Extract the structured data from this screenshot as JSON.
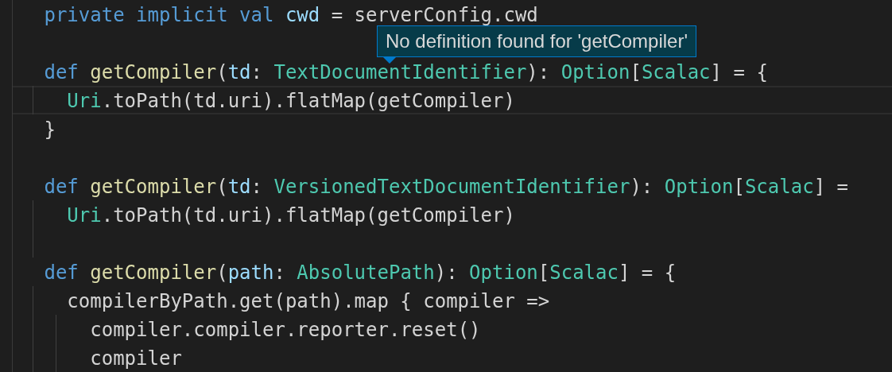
{
  "editor": {
    "lines": [
      {
        "highlighted": false,
        "tokens": [
          {
            "kind": "keyword",
            "text": "private implicit val "
          },
          {
            "kind": "parameter",
            "text": "cwd"
          },
          {
            "kind": "plain",
            "text": " = serverConfig.cwd"
          }
        ]
      },
      {
        "highlighted": false
      },
      {
        "highlighted": false,
        "tokens": [
          {
            "kind": "keyword",
            "text": "def "
          },
          {
            "kind": "function",
            "text": "getCompiler"
          },
          {
            "kind": "plain",
            "text": "("
          },
          {
            "kind": "parameter",
            "text": "td"
          },
          {
            "kind": "plain",
            "text": ": "
          },
          {
            "kind": "type",
            "text": "TextDocumentIdentifier"
          },
          {
            "kind": "plain",
            "text": "): "
          },
          {
            "kind": "type",
            "text": "Option"
          },
          {
            "kind": "plain",
            "text": "["
          },
          {
            "kind": "type",
            "text": "Scalac"
          },
          {
            "kind": "plain",
            "text": "] = {"
          }
        ],
        "children": [
          {
            "highlighted": true,
            "tokens": [
              {
                "kind": "type",
                "text": "Uri"
              },
              {
                "kind": "plain",
                "text": ".toPath(td.uri).flatMap(getCompiler)"
              }
            ]
          }
        ]
      },
      {
        "highlighted": false,
        "tokens": [
          {
            "kind": "plain",
            "text": "}"
          }
        ]
      },
      {
        "highlighted": false
      },
      {
        "highlighted": false,
        "tokens": [
          {
            "kind": "keyword",
            "text": "def "
          },
          {
            "kind": "function",
            "text": "getCompiler"
          },
          {
            "kind": "plain",
            "text": "("
          },
          {
            "kind": "parameter",
            "text": "td"
          },
          {
            "kind": "plain",
            "text": ": "
          },
          {
            "kind": "type",
            "text": "VersionedTextDocumentIdentifier"
          },
          {
            "kind": "plain",
            "text": "): "
          },
          {
            "kind": "type",
            "text": "Option"
          },
          {
            "kind": "plain",
            "text": "["
          },
          {
            "kind": "type",
            "text": "Scalac"
          },
          {
            "kind": "plain",
            "text": "] ="
          }
        ],
        "children": [
          {
            "highlighted": false,
            "tokens": [
              {
                "kind": "type",
                "text": "Uri"
              },
              {
                "kind": "plain",
                "text": ".toPath(td.uri).flatMap(getCompiler)"
              }
            ]
          },
          {
            "highlighted": false
          }
        ]
      },
      {
        "highlighted": false,
        "tokens": [
          {
            "kind": "keyword",
            "text": "def "
          },
          {
            "kind": "function",
            "text": "getCompiler"
          },
          {
            "kind": "plain",
            "text": "("
          },
          {
            "kind": "parameter",
            "text": "path"
          },
          {
            "kind": "plain",
            "text": ": "
          },
          {
            "kind": "type",
            "text": "AbsolutePath"
          },
          {
            "kind": "plain",
            "text": "): "
          },
          {
            "kind": "type",
            "text": "Option"
          },
          {
            "kind": "plain",
            "text": "["
          },
          {
            "kind": "type",
            "text": "Scalac"
          },
          {
            "kind": "plain",
            "text": "] = {"
          }
        ],
        "children": [
          {
            "highlighted": false,
            "tokens": [
              {
                "kind": "plain",
                "text": "compilerByPath.get(path).map { compiler =>"
              }
            ],
            "children": [
              {
                "highlighted": false,
                "tokens": [
                  {
                    "kind": "plain",
                    "text": "compiler.compiler.reporter.reset()"
                  }
                ]
              },
              {
                "highlighted": false,
                "tokens": [
                  {
                    "kind": "plain",
                    "text": "compiler"
                  }
                ]
              }
            ]
          }
        ]
      }
    ]
  },
  "hover_tooltip": {
    "text": "No definition found for 'getCompiler'"
  }
}
